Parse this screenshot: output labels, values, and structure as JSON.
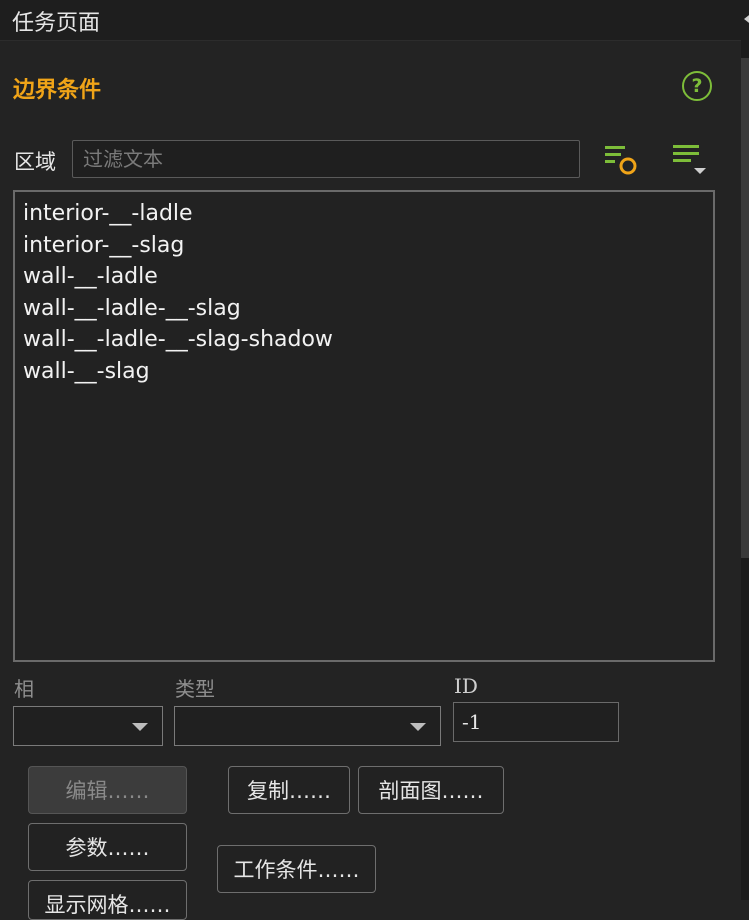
{
  "window": {
    "title": "任务页面"
  },
  "panel": {
    "section_title": "边界条件",
    "help_label": "?",
    "zone_label": "区域",
    "filter_placeholder": "过滤文本",
    "zones": [
      "interior-__-ladle",
      "interior-__-slag",
      "wall-__-ladle",
      "wall-__-ladle-__-slag",
      "wall-__-ladle-__-slag-shadow",
      "wall-__-slag"
    ],
    "phase_label": "相",
    "phase_value": "",
    "type_label": "类型",
    "type_value": "",
    "id_label": "ID",
    "id_value": "-1",
    "buttons": {
      "edit": "编辑……",
      "copy": "复制……",
      "profile": "剖面图……",
      "parameters": "参数……",
      "operating_conditions": "工作条件……",
      "display_mesh": "显示网格……"
    }
  },
  "colors": {
    "accent_orange": "#f0a418",
    "accent_green": "#7dbd39",
    "background": "#232323"
  },
  "icons": {
    "filter_options": "filter-settings-icon",
    "list_options": "list-menu-icon",
    "help": "help-icon"
  }
}
